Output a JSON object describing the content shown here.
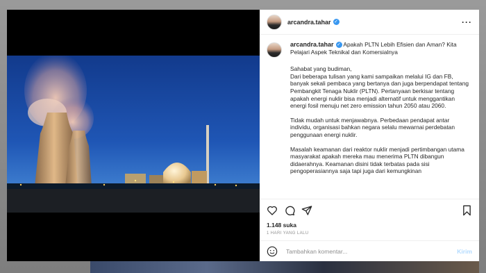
{
  "post": {
    "username": "arcandra.tahar",
    "caption": {
      "title": "Apakah PLTN Lebih Efisien dan Aman? Kita Pelajari Aspek Teknikal dan Komersialnya",
      "p1": "Sahabat yang budiman,\nDari beberapa tulisan yang kami sampaikan melalui IG dan FB, banyak sekali pembaca yang bertanya dan juga berpendapat tentang Pembangkit Tenaga Nuklir (PLTN). Pertanyaan berkisar tentang apakah energi nuklir bisa menjadi alternatif untuk menggantikan energi fosil menuju net zero emission tahun 2050 atau 2060.",
      "p2": "Tidak mudah untuk menjawabnya. Perbedaan pendapat antar individu, organisasi bahkan negara selalu mewarnai perdebatan penggunaan energi nuklir.",
      "p3": "Masalah keamanan dari reaktor nuklir menjadi pertimbangan utama masyarakat apakah mereka mau menerima PLTN dibangun didaerahnya. Keamanan disini tidak terbatas pada sisi pengoperasiannya saja tapi juga dari kemungkinan"
    },
    "likes": "1.148 suka",
    "time": "1 HARI YANG LALU"
  },
  "comment": {
    "placeholder": "Tambahkan komentar...",
    "post_label": "Kirim"
  },
  "icons": {
    "more": "more-options-icon",
    "like": "heart-icon",
    "comment": "comment-icon",
    "share": "share-icon",
    "save": "bookmark-icon",
    "emoji": "emoji-icon",
    "verified": "verified-badge-icon"
  },
  "colors": {
    "verified": "#3897f0",
    "post_button": "#b3dbff",
    "secondary_text": "#8e8e8e"
  }
}
